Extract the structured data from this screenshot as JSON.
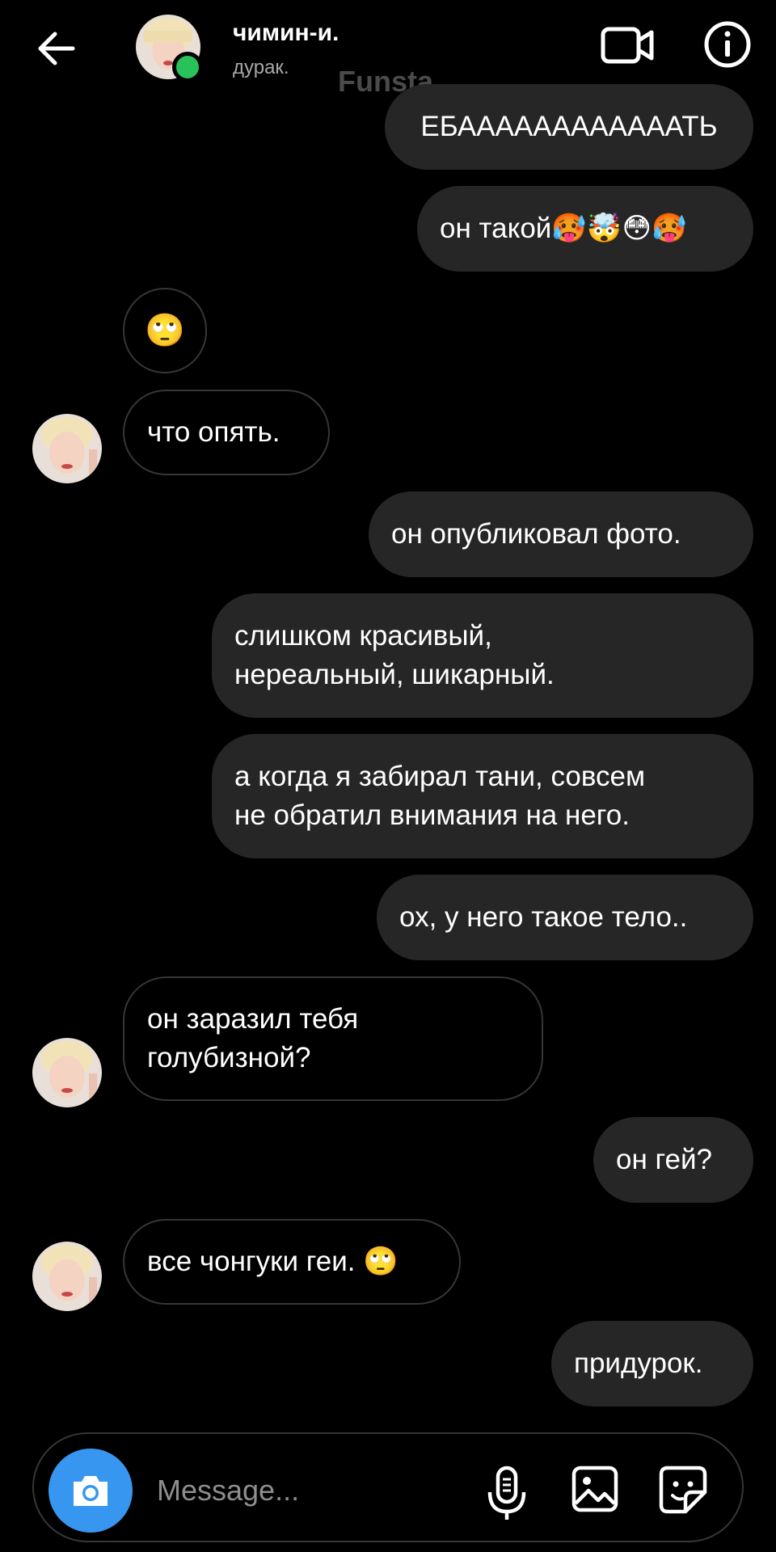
{
  "header": {
    "name": "чимин-и.",
    "status": "дурак.",
    "watermark": "Funsta"
  },
  "messages": [
    {
      "side": "out",
      "text": "ЕБААААААААААААТЬ"
    },
    {
      "side": "out",
      "text": "он такой🥵🤯😳🥵"
    },
    {
      "side": "in",
      "text": "🙄"
    },
    {
      "side": "in",
      "text": "что опять."
    },
    {
      "side": "out",
      "text": "он опубликовал фото."
    },
    {
      "side": "out",
      "text": "слишком красивый,\nнереальный, шикарный."
    },
    {
      "side": "out",
      "text": "а когда я забирал тани, совсем\nне обратил внимания на него."
    },
    {
      "side": "out",
      "text": "ох, у него такое тело.."
    },
    {
      "side": "in",
      "text": "он заразил тебя\nголубизной?"
    },
    {
      "side": "out",
      "text": "он гей?"
    },
    {
      "side": "in",
      "text": "все чонгуки геи. 🙄"
    },
    {
      "side": "out",
      "text": "придурок."
    }
  ],
  "composer": {
    "placeholder": "Message..."
  },
  "icons": {
    "back": "arrow-left-icon",
    "video": "video-camera-icon",
    "info": "info-icon",
    "camera": "camera-icon",
    "mic": "microphone-icon",
    "gallery": "image-icon",
    "sticker": "sticker-icon"
  },
  "colors": {
    "background": "#000000",
    "outgoing_bubble": "#262626",
    "incoming_border": "#363636",
    "camera_button": "#3797f0",
    "online": "#29c15a"
  }
}
